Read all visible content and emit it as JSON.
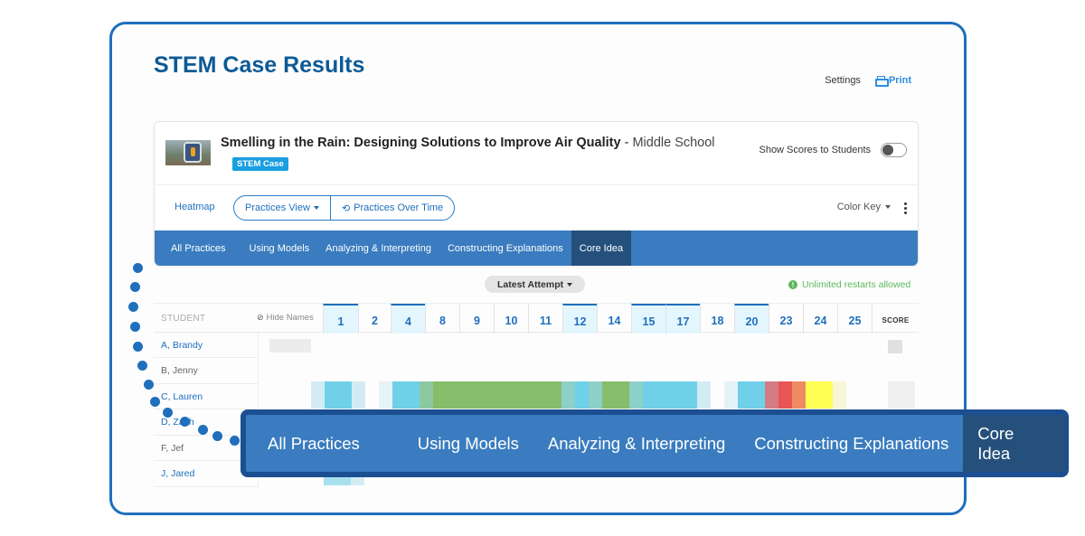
{
  "page": {
    "title": "STEM Case Results",
    "settings_label": "Settings",
    "print_label": "Print"
  },
  "case": {
    "title": "Smelling in the Rain: Designing Solutions to Improve Air Quality",
    "separator": " - ",
    "level": "Middle School",
    "tag": "STEM Case",
    "show_scores_label": "Show Scores to Students",
    "show_scores_on": false
  },
  "toolbar": {
    "heatmap_label": "Heatmap",
    "practices_view_label": "Practices View",
    "practices_over_time_label": "Practices Over Time",
    "color_key_label": "Color Key"
  },
  "tabs": [
    {
      "label": "All Practices",
      "active": false
    },
    {
      "label": "Using Models",
      "active": false
    },
    {
      "label": "Analyzing & Interpreting",
      "active": false
    },
    {
      "label": "Constructing Explanations",
      "active": false
    },
    {
      "label": "Core Idea",
      "active": true
    }
  ],
  "filter": {
    "attempt_label": "Latest Attempt",
    "notice": "Unlimited restarts allowed"
  },
  "table": {
    "student_header": "STUDENT",
    "hide_names_label": "Hide Names",
    "score_header": "SCORE",
    "questions": [
      {
        "label": "1",
        "highlighted": true
      },
      {
        "label": "2",
        "highlighted": false
      },
      {
        "label": "4",
        "highlighted": true
      },
      {
        "label": "8",
        "highlighted": false
      },
      {
        "label": "9",
        "highlighted": false
      },
      {
        "label": "10",
        "highlighted": false
      },
      {
        "label": "11",
        "highlighted": false
      },
      {
        "label": "12",
        "highlighted": true
      },
      {
        "label": "14",
        "highlighted": false
      },
      {
        "label": "15",
        "highlighted": true
      },
      {
        "label": "17",
        "highlighted": true
      },
      {
        "label": "18",
        "highlighted": false
      },
      {
        "label": "20",
        "highlighted": true
      },
      {
        "label": "23",
        "highlighted": false
      },
      {
        "label": "24",
        "highlighted": false
      },
      {
        "label": "25",
        "highlighted": false
      }
    ],
    "students": [
      {
        "name": "A, Brandy",
        "link": true
      },
      {
        "name": "B, Jenny",
        "link": false
      },
      {
        "name": "C, Lauren",
        "link": true
      },
      {
        "name": "D, Zach",
        "link": true
      },
      {
        "name": "F, Jef",
        "link": false
      },
      {
        "name": "J, Jared",
        "link": true
      }
    ],
    "heat_colors": {
      "blue": "#6fd0e8",
      "light_blue": "#d3ecf4",
      "green": "#86bd6a",
      "teal": "#8cd0c8",
      "pink": "#d47c84",
      "red": "#e85555",
      "orange": "#ef8a62",
      "yellow": "#ffff55",
      "pale_yellow": "#f8f6d8",
      "grey": "#ececec"
    }
  },
  "callout": {
    "tabs": [
      {
        "label": "All Practices",
        "active": false
      },
      {
        "label": "Using Models",
        "active": false
      },
      {
        "label": "Analyzing & Interpreting",
        "active": false
      },
      {
        "label": "Constructing Explanations",
        "active": false
      },
      {
        "label": "Core Idea",
        "active": true
      }
    ]
  }
}
